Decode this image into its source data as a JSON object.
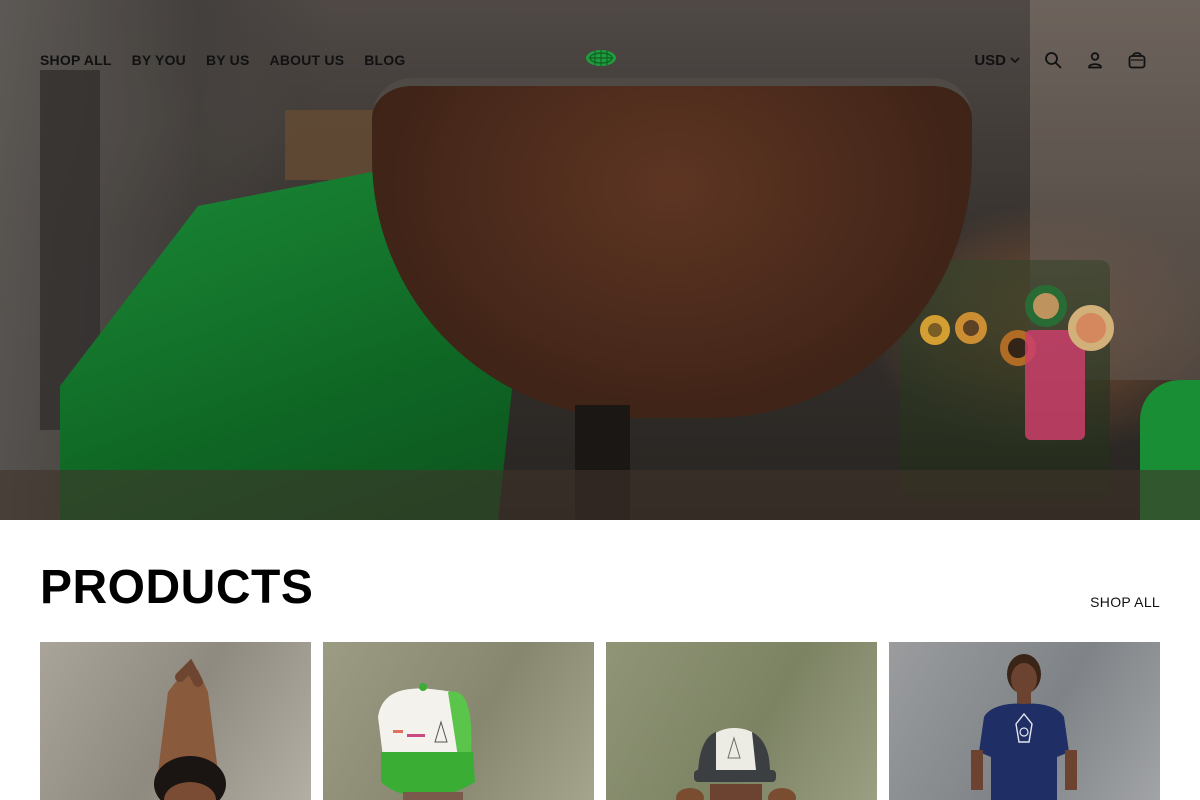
{
  "nav": {
    "items": [
      {
        "label": "SHOP ALL"
      },
      {
        "label": "BY YOU"
      },
      {
        "label": "BY US"
      },
      {
        "label": "ABOUT US"
      },
      {
        "label": "BLOG"
      }
    ]
  },
  "header": {
    "currency": "USD",
    "logo_color": "#1f9c3e",
    "icons": [
      "search-icon",
      "account-icon",
      "cart-icon"
    ]
  },
  "products": {
    "title": "PRODUCTS",
    "shop_all_label": "SHOP ALL",
    "items": [
      {
        "image": "model-arms-raised"
      },
      {
        "image": "model-green-trucker-hat"
      },
      {
        "image": "model-white-trucker-hat"
      },
      {
        "image": "model-navy-tshirt"
      }
    ]
  },
  "colors": {
    "accent_green": "#1f9c3e",
    "text": "#111111",
    "background": "#ffffff"
  }
}
